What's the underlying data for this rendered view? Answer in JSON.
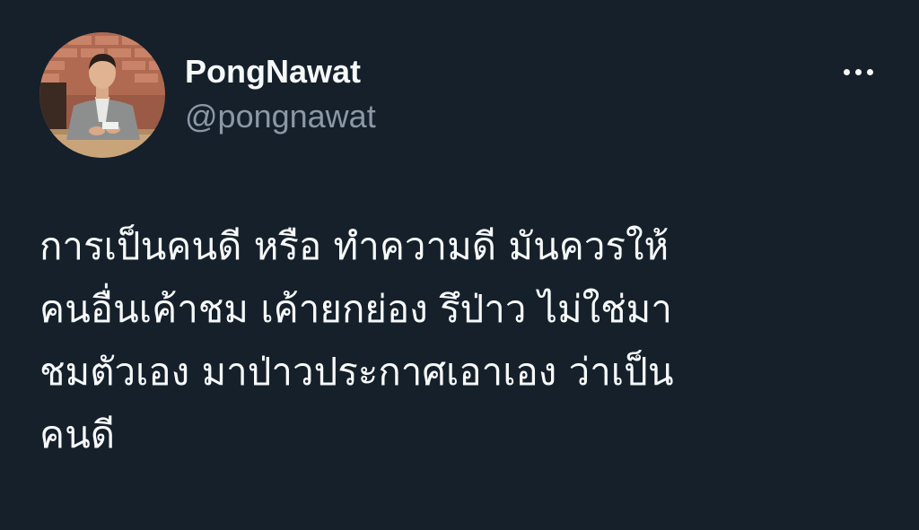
{
  "tweet": {
    "author": {
      "display_name": "PongNawat",
      "handle": "@pongnawat",
      "avatar": "profile-photo"
    },
    "more_icon": "more-horizontal-icon",
    "text_lines": [
      "การเป็นคนดี หรือ ทำความดี มันควรให้",
      "คนอื่นเค้าชม เค้ายกย่อง รึป่าว ไม่ใช่มา",
      "ชมตัวเอง มาป่าวประกาศเอาเอง ว่าเป็น",
      "คนดี"
    ]
  },
  "colors": {
    "background": "#15202b",
    "primary_text": "#f7f9f9",
    "secondary_text": "#8b98a5"
  }
}
